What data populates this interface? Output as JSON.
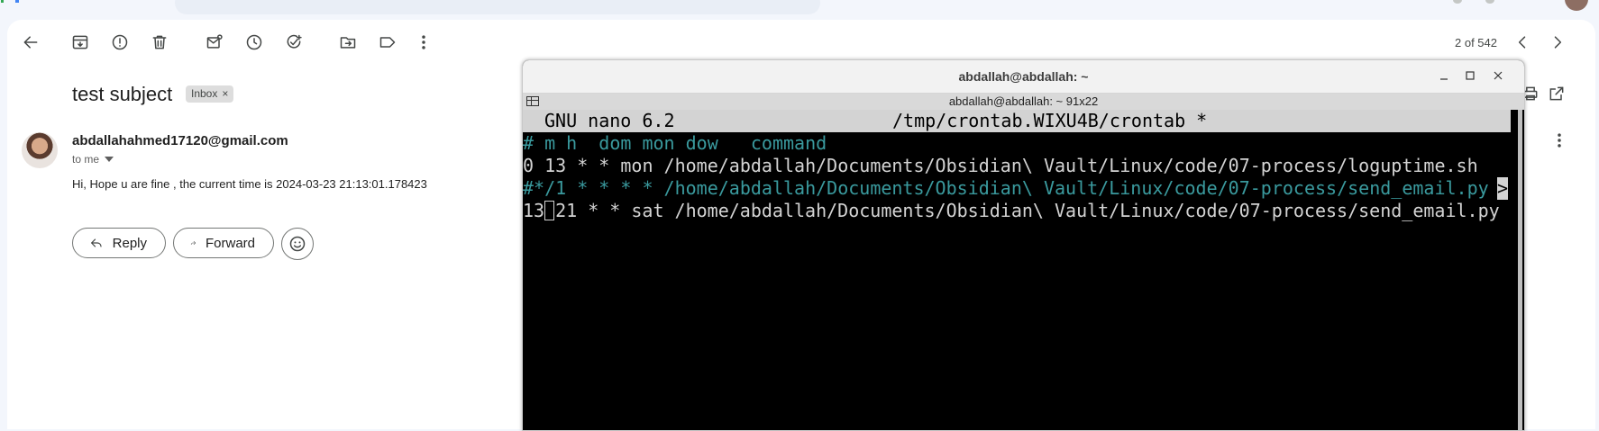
{
  "gmail": {
    "pager": "2 of 542",
    "subject": "test subject",
    "label": "Inbox",
    "label_remove": "×",
    "sender_email": "abdallahahmed17120@gmail.com",
    "to_me": "to me",
    "body": "Hi, Hope u are fine , the current time is 2024-03-23 21:13:01.178423",
    "reply_label": "Reply",
    "forward_label": "Forward",
    "toolbar_icons": [
      "back-arrow-icon",
      "archive-icon",
      "report-spam-icon",
      "delete-icon",
      "mark-unread-icon",
      "snooze-icon",
      "add-to-tasks-icon",
      "move-to-icon",
      "label-icon",
      "more-vert-icon"
    ]
  },
  "terminal": {
    "window_title": "abdallah@abdallah: ~",
    "tab_title": "abdallah@abdallah: ~ 91x22",
    "nano_version": "GNU nano 6.2",
    "file_name": "/tmp/crontab.WIXU4B/crontab *",
    "lines": [
      "# m h  dom mon dow   command",
      "0 13 * * mon /home/abdallah/Documents/Obsidian\\ Vault/Linux/code/07-process/loguptime.sh",
      "#*/1 * * * * /home/abdallah/Documents/Obsidian\\ Vault/Linux/code/07-process/send_email.py",
      "21 * * sat /home/abdallah/Documents/Obsidian\\ Vault/Linux/code/07-process/send_email.py"
    ],
    "line4_prefix": "13",
    "overflow_marker": ">"
  }
}
